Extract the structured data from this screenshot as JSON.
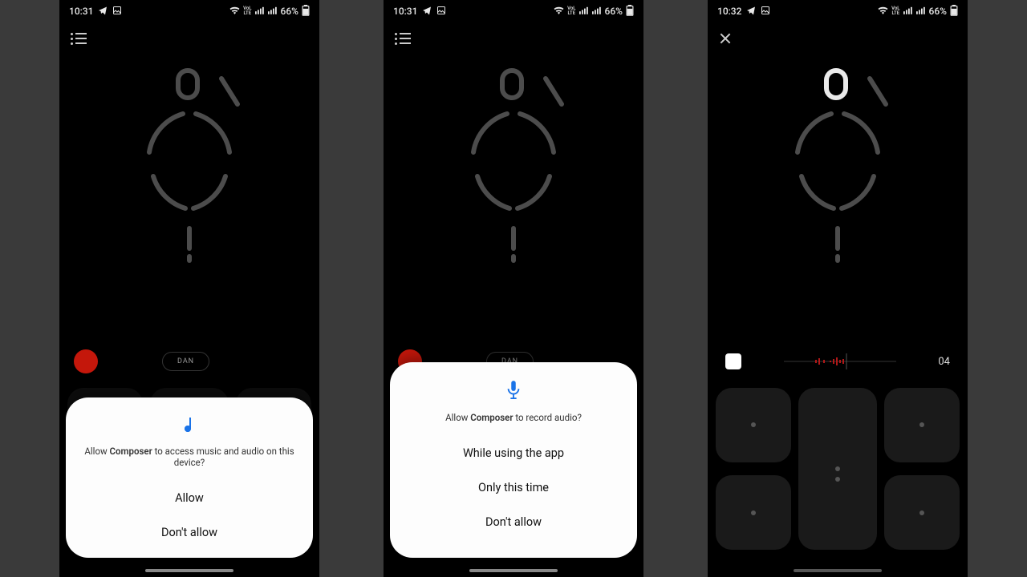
{
  "status": {
    "time_a": "10:31",
    "time_b": "10:31",
    "time_c": "10:32",
    "battery": "66%",
    "send_icon": "✈",
    "image_icon": "🖼",
    "wifi_icon": "📶",
    "vol_label": "VoLTE",
    "signal_icon": "📶",
    "battery_icon": "🔋"
  },
  "app": {
    "pill_label": "DAN",
    "counter": "04"
  },
  "perm1": {
    "prefix": "Allow ",
    "app_name": "Composer",
    "suffix": " to access music and audio on this device?",
    "allow": "Allow",
    "deny": "Don't allow"
  },
  "perm2": {
    "prefix": "Allow ",
    "app_name": "Composer",
    "suffix": " to record audio?",
    "while": "While using the app",
    "once": "Only this time",
    "deny": "Don't allow"
  }
}
